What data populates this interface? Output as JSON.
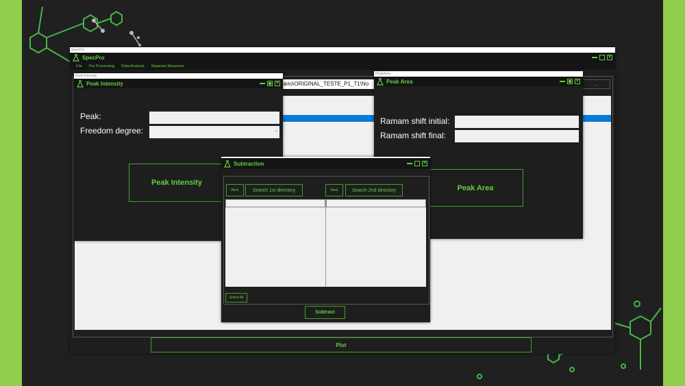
{
  "main_window": {
    "sys_title": "SpecPro",
    "title": "SpecPro",
    "menu": [
      "File",
      "Pre Processing",
      "Data Analysis",
      "Separate Measures"
    ],
    "path_text": "ntário\\ORIGINAL_TESTE_P1_T1\\No",
    "browse_label": "...",
    "plot_label": "Plot"
  },
  "peak_intensity": {
    "sys_title": "Peak Intensity",
    "title": "Peak Intensity",
    "peak_label": "Peak:",
    "freedom_label": "Freedom degree:",
    "freedom_value": "-",
    "button_label": "Peak Intensity"
  },
  "peak_area": {
    "sys_title": "PeakArea",
    "title": "Peak Area",
    "initial_label": "Ramam shift initial:",
    "final_label": "Ramam shift final:",
    "button_label": "Peak Area"
  },
  "subtraction": {
    "title": "Subtraction",
    "back1": "Back",
    "search1": "Search 1st directory",
    "back2": "Back",
    "search2": "Search 2nd directory",
    "select_all": "Select All",
    "subtract": "Subtract"
  },
  "colors": {
    "accent": "#62d13e",
    "side_bar": "#8fce4a",
    "selection": "#0a7ad7"
  }
}
